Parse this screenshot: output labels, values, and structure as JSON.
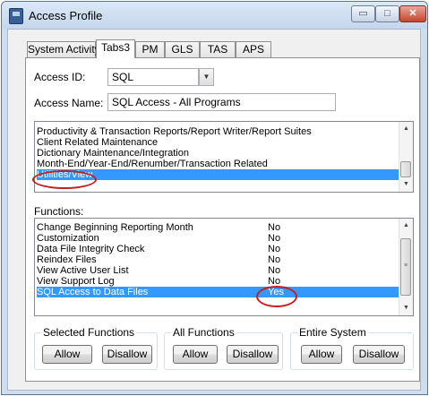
{
  "window": {
    "title": "Access Profile",
    "controls": {
      "minimize": "▭",
      "maximize": "□",
      "close": "✕"
    }
  },
  "tabs": [
    {
      "label": "System Activity",
      "active": false
    },
    {
      "label": "Tabs3",
      "active": true
    },
    {
      "label": "PM",
      "active": false
    },
    {
      "label": "GLS",
      "active": false
    },
    {
      "label": "TAS",
      "active": false
    },
    {
      "label": "APS",
      "active": false
    }
  ],
  "form": {
    "access_id_label": "Access ID:",
    "access_id_value": "SQL",
    "access_name_label": "Access Name:",
    "access_name_value": "SQL Access - All Programs"
  },
  "areas": {
    "items": [
      "Productivity & Transaction Reports/Report Writer/Report Suites",
      "Client Related Maintenance",
      "Dictionary Maintenance/Integration",
      "Month-End/Year-End/Renumber/Transaction Related",
      "Utilities/View"
    ],
    "selected_index": 4
  },
  "functions": {
    "label": "Functions:",
    "items": [
      {
        "name": "Change Beginning Reporting Month",
        "value": "No"
      },
      {
        "name": "Customization",
        "value": "No"
      },
      {
        "name": "Data File Integrity Check",
        "value": "No"
      },
      {
        "name": "Reindex Files",
        "value": "No"
      },
      {
        "name": "View Active User List",
        "value": "No"
      },
      {
        "name": "View Support Log",
        "value": "No"
      },
      {
        "name": "SQL Access to Data Files",
        "value": "Yes"
      }
    ],
    "selected_index": 6
  },
  "groups": {
    "selected": {
      "title": "Selected Functions",
      "allow": "Allow",
      "disallow": "Disallow"
    },
    "all": {
      "title": "All Functions",
      "allow": "Allow",
      "disallow": "Disallow"
    },
    "system": {
      "title": "Entire System",
      "allow": "Allow",
      "disallow": "Disallow"
    }
  },
  "colors": {
    "selection": "#3399ff",
    "annotation": "#c02020",
    "window_frame": "#cfdeee"
  }
}
